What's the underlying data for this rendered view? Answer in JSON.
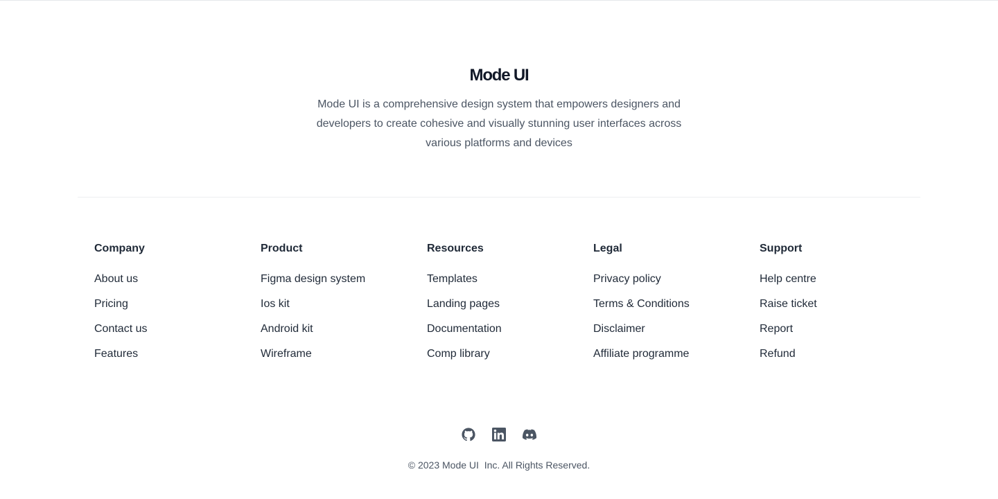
{
  "brand": {
    "name": "Mode UI",
    "tagline": "Mode UI is a comprehensive design system that empowers designers and developers to create cohesive and visually stunning user interfaces across various platforms and devices"
  },
  "columns": [
    {
      "heading": "Company",
      "links": [
        "About us",
        "Pricing",
        "Contact us",
        "Features"
      ]
    },
    {
      "heading": "Product",
      "links": [
        "Figma design system",
        "Ios kit",
        "Android kit",
        "Wireframe"
      ]
    },
    {
      "heading": "Resources",
      "links": [
        "Templates",
        "Landing pages",
        "Documentation",
        "Comp library"
      ]
    },
    {
      "heading": "Legal",
      "links": [
        "Privacy policy",
        "Terms & Conditions",
        "Disclaimer",
        "Affiliate programme"
      ]
    },
    {
      "heading": "Support",
      "links": [
        "Help centre",
        "Raise ticket",
        "Report",
        "Refund"
      ]
    }
  ],
  "socials": [
    {
      "icon": "github-icon"
    },
    {
      "icon": "linkedin-icon"
    },
    {
      "icon": "discord-icon"
    }
  ],
  "copyright": "© 2023 Mode UI  Inc. All Rights Reserved.",
  "colors": {
    "heading": "#1f2937",
    "body_text": "#4b5563",
    "divider": "#eceef1"
  }
}
